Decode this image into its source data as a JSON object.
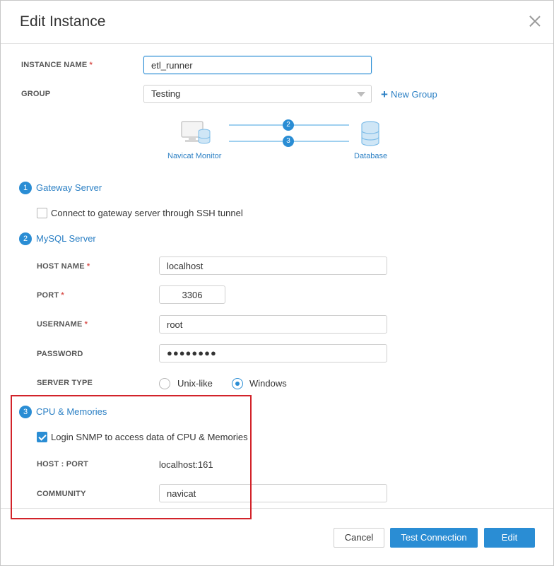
{
  "dialog": {
    "title": "Edit Instance"
  },
  "instance_name": {
    "label": "INSTANCE NAME",
    "required_mark": "*",
    "value": "etl_runner"
  },
  "group": {
    "label": "GROUP",
    "value": "Testing",
    "new_group_label": "New Group"
  },
  "diagram": {
    "monitor_label": "Navicat Monitor",
    "database_label": "Database",
    "link_steps": [
      "2",
      "3"
    ]
  },
  "gateway": {
    "step": "1",
    "title": "Gateway Server",
    "ssh_checkbox_label": "Connect to gateway server through SSH tunnel",
    "ssh_checked": false
  },
  "mysql": {
    "step": "2",
    "title": "MySQL Server",
    "host_label": "HOST NAME",
    "host_value": "localhost",
    "port_label": "PORT",
    "port_value": "3306",
    "username_label": "USERNAME",
    "username_value": "root",
    "password_label": "PASSWORD",
    "password_value": "●●●●●●●●",
    "server_type_label": "SERVER TYPE",
    "server_type_options": [
      "Unix-like",
      "Windows"
    ],
    "server_type_selected": "Windows"
  },
  "cpu": {
    "step": "3",
    "title": "CPU & Memories",
    "snmp_checkbox_label": "Login SNMP to access data of CPU & Memories",
    "snmp_checked": true,
    "host_port_label": "HOST : PORT",
    "host_port_value": "localhost:161",
    "community_label": "COMMUNITY",
    "community_value": "navicat"
  },
  "footer": {
    "cancel_label": "Cancel",
    "test_label": "Test Connection",
    "edit_label": "Edit"
  },
  "colors": {
    "accent": "#2a8dd4",
    "link": "#2a7fc4",
    "required": "#d9534f",
    "highlight_box": "#d2232a"
  }
}
